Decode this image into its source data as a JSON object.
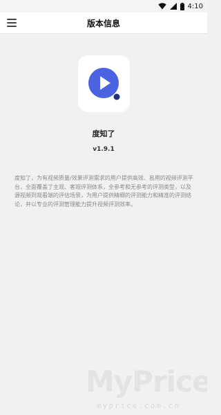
{
  "status_bar": {
    "time": "4:10",
    "icons": [
      "wifi-icon",
      "cellular-signal-icon",
      "battery-icon"
    ]
  },
  "app_bar": {
    "title": "版本信息",
    "menu_icon": "hamburger-menu-icon"
  },
  "app_info": {
    "logo_icon": "play-app-logo-icon",
    "logo_color": "#4a63e0",
    "logo_dot_color": "#1f2f7a",
    "name": "度知了",
    "version": "v1.9.1",
    "description": "度知了，为有视频质量/效果评测需求的用户提供高效、易用的视频评测平台，全面覆盖了主观、客观评测体系，全参考和无参考的评测类型，以及源视频到观看端的评估场景，为用户提供精细的评测能力和精准的评测结论，并以专业的评测管理能力提升视频评测效率。"
  },
  "watermark": {
    "main": "MyPrice",
    "url": "myprice.com.cn"
  }
}
